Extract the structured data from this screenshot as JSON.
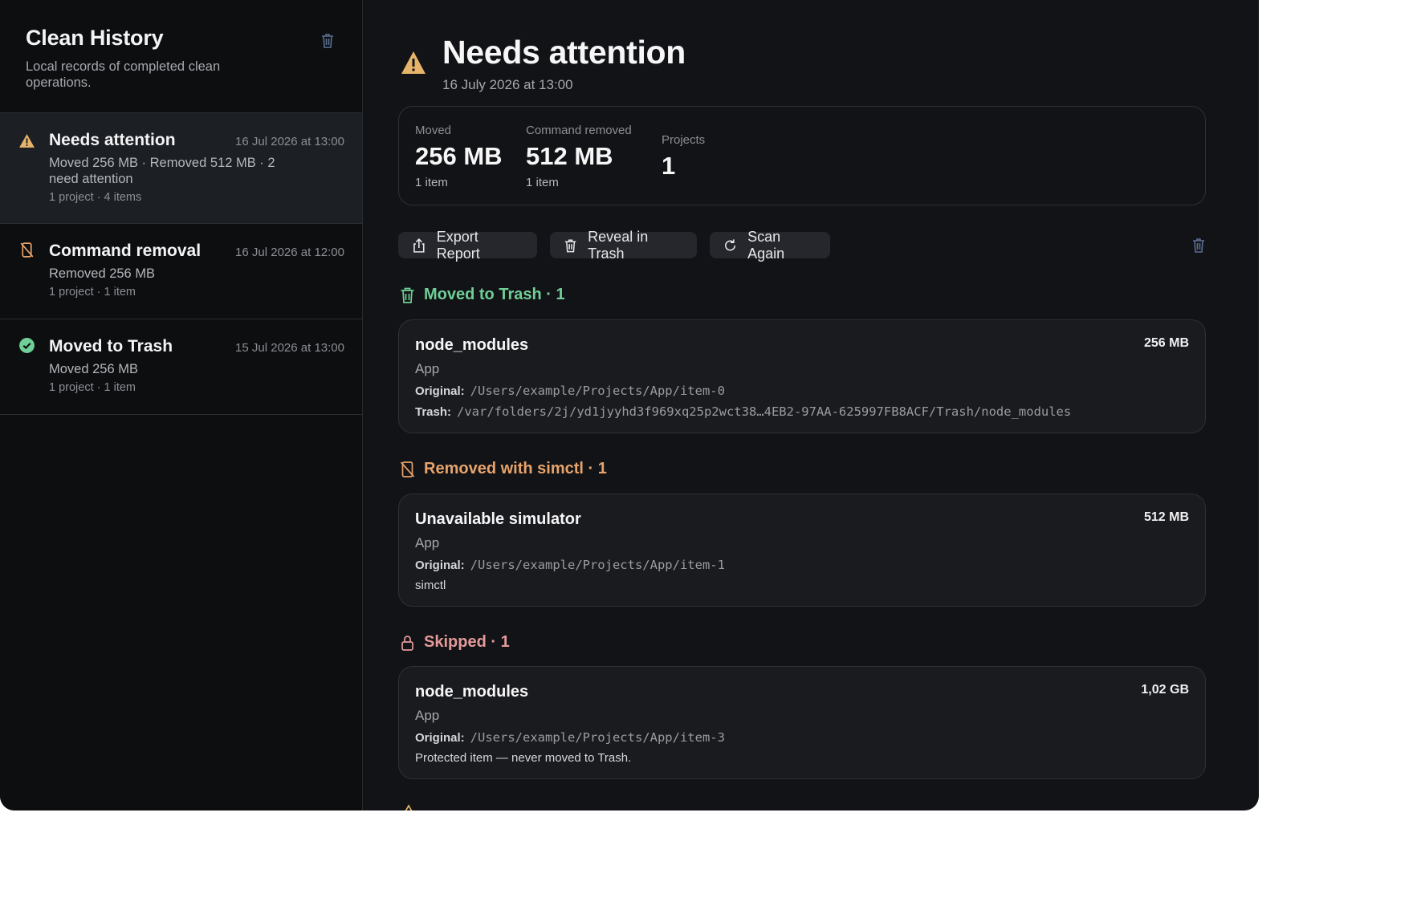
{
  "sidebar": {
    "title": "Clean History",
    "subtitle": "Local records of completed clean operations.",
    "items": [
      {
        "title": "Needs attention",
        "date": "16 Jul 2026 at 13:00",
        "line1": "Moved 256 MB · Removed 512 MB · 2 need attention",
        "meta": "1 project · 4 items",
        "icon": "warning-icon",
        "selected": true
      },
      {
        "title": "Command removal",
        "date": "16 Jul 2026 at 12:00",
        "line1": "Removed 256 MB",
        "meta": "1 project · 1 item",
        "icon": "phone-slash-icon",
        "selected": false
      },
      {
        "title": "Moved to Trash",
        "date": "15 Jul 2026 at 13:00",
        "line1": "Moved 256 MB",
        "meta": "1 project · 1 item",
        "icon": "check-circle-icon",
        "selected": false
      }
    ]
  },
  "detail": {
    "title": "Needs attention",
    "date": "16 July 2026 at 13:00",
    "stats": {
      "moved": {
        "label": "Moved",
        "value": "256 MB",
        "note": "1 item"
      },
      "removed": {
        "label": "Command removed",
        "value": "512 MB",
        "note": "1 item"
      },
      "projects": {
        "label": "Projects",
        "value": "1"
      }
    },
    "toolbar": {
      "export": "Export Report",
      "reveal": "Reveal in Trash",
      "scan": "Scan Again"
    },
    "sections": {
      "moved": {
        "heading": "Moved to Trash · 1",
        "color": "#6fcf97",
        "card": {
          "name": "node_modules",
          "size": "256 MB",
          "project": "App",
          "original_label": "Original:",
          "original_path": "/Users/example/Projects/App/item-0",
          "trash_label": "Trash:",
          "trash_path": "/var/folders/2j/yd1jyyhd3f969xq25p2wct38…4EB2-97AA-625997FB8ACF/Trash/node_modules"
        }
      },
      "removed": {
        "heading": "Removed with simctl · 1",
        "color": "#e8a36c",
        "card": {
          "name": "Unavailable simulator",
          "size": "512 MB",
          "project": "App",
          "original_label": "Original:",
          "original_path": "/Users/example/Projects/App/item-1",
          "note": "simctl"
        }
      },
      "skipped": {
        "heading": "Skipped · 1",
        "color": "#e49a9a",
        "card": {
          "name": "node_modules",
          "size": "1,02 GB",
          "project": "App",
          "original_label": "Original:",
          "original_path": "/Users/example/Projects/App/item-3",
          "note": "Protected item — never moved to Trash."
        }
      }
    }
  },
  "colors": {
    "warning": "#e5b46a",
    "success": "#6fcf97",
    "accent_orange": "#e8a36c",
    "skipped": "#e49a9a"
  }
}
